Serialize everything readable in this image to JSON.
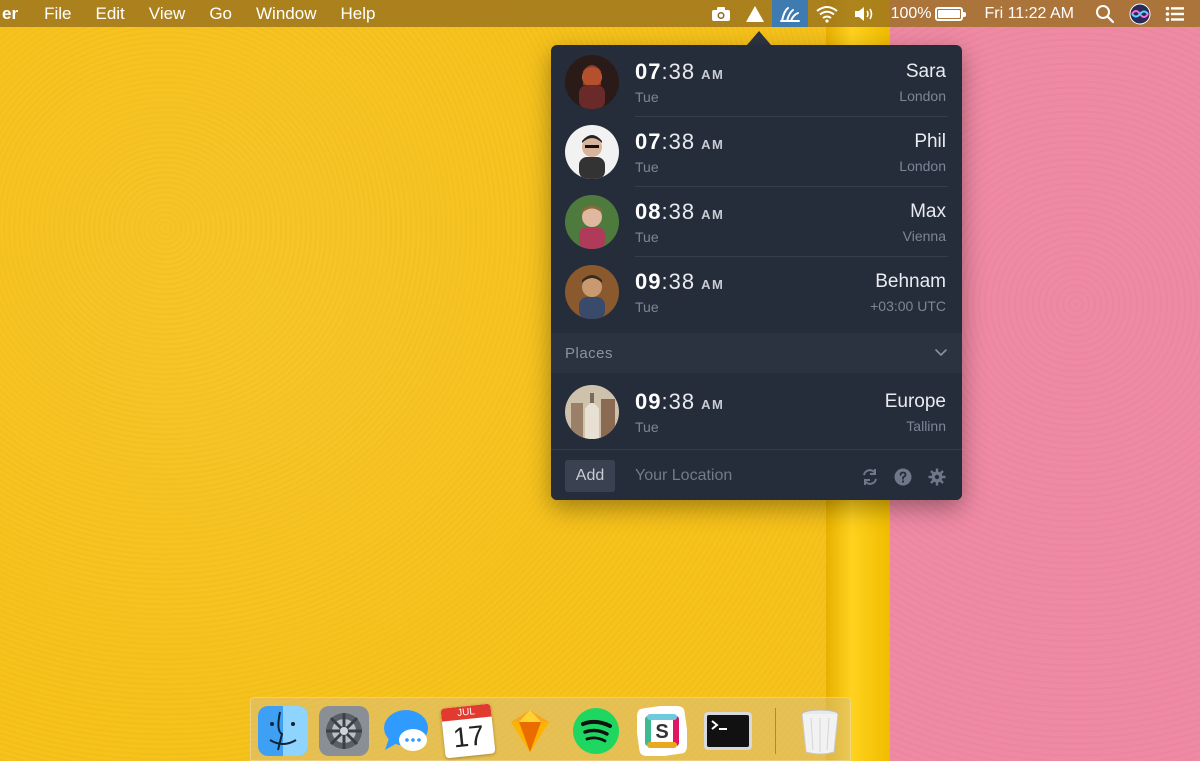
{
  "menubar": {
    "app_name": "er",
    "menus": [
      "File",
      "Edit",
      "View",
      "Go",
      "Window",
      "Help"
    ],
    "battery": "100%",
    "clock": "Fri 11:22 AM"
  },
  "people": [
    {
      "hour": "07",
      "minute": ":38",
      "ampm": "AM",
      "day": "Tue",
      "name": "Sara",
      "place": "London",
      "avatar_color": "#7a3b2a"
    },
    {
      "hour": "07",
      "minute": ":38",
      "ampm": "AM",
      "day": "Tue",
      "name": "Phil",
      "place": "London",
      "avatar_color": "#e8e8e8"
    },
    {
      "hour": "08",
      "minute": ":38",
      "ampm": "AM",
      "day": "Tue",
      "name": "Max",
      "place": "Vienna",
      "avatar_color": "#5a7a4a"
    },
    {
      "hour": "09",
      "minute": ":38",
      "ampm": "AM",
      "day": "Tue",
      "name": "Behnam",
      "place": "+03:00 UTC",
      "avatar_color": "#8a5a32"
    }
  ],
  "places_section": {
    "label": "Places"
  },
  "places": [
    {
      "hour": "09",
      "minute": ":38",
      "ampm": "AM",
      "day": "Tue",
      "name": "Europe",
      "place": "Tallinn",
      "avatar_color": "#b9a58a"
    }
  ],
  "footer": {
    "add_label": "Add",
    "location_placeholder": "Your Location"
  },
  "dock": {
    "apps": [
      "finder-icon",
      "system-preferences-icon",
      "messages-icon",
      "calendar-icon",
      "sketch-icon",
      "spotify-icon",
      "slack-icon",
      "terminal-icon",
      "trash-icon"
    ],
    "calendar_month": "JUL",
    "calendar_day": "17"
  }
}
